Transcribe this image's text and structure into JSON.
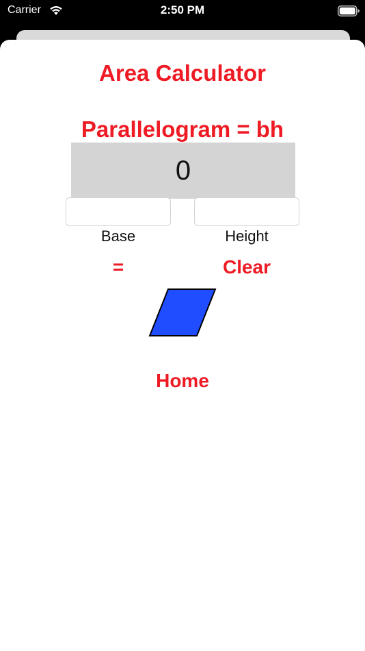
{
  "status_bar": {
    "carrier": "Carrier",
    "time": "2:50 PM",
    "icons": [
      "wifi-icon",
      "battery-icon"
    ]
  },
  "app": {
    "title": "Area Calculator",
    "formula": "Parallelogram = bh",
    "result": "0"
  },
  "inputs": {
    "base": {
      "value": "",
      "placeholder": "",
      "label": "Base"
    },
    "height": {
      "value": "",
      "placeholder": "",
      "label": "Height"
    }
  },
  "buttons": {
    "equals": "=",
    "clear": "Clear",
    "home": "Home"
  },
  "colors": {
    "accent": "#ee1a24",
    "result_background": "#d4d4d4",
    "shape_fill": "#1f4dff"
  },
  "shape_icon": "parallelogram-icon"
}
